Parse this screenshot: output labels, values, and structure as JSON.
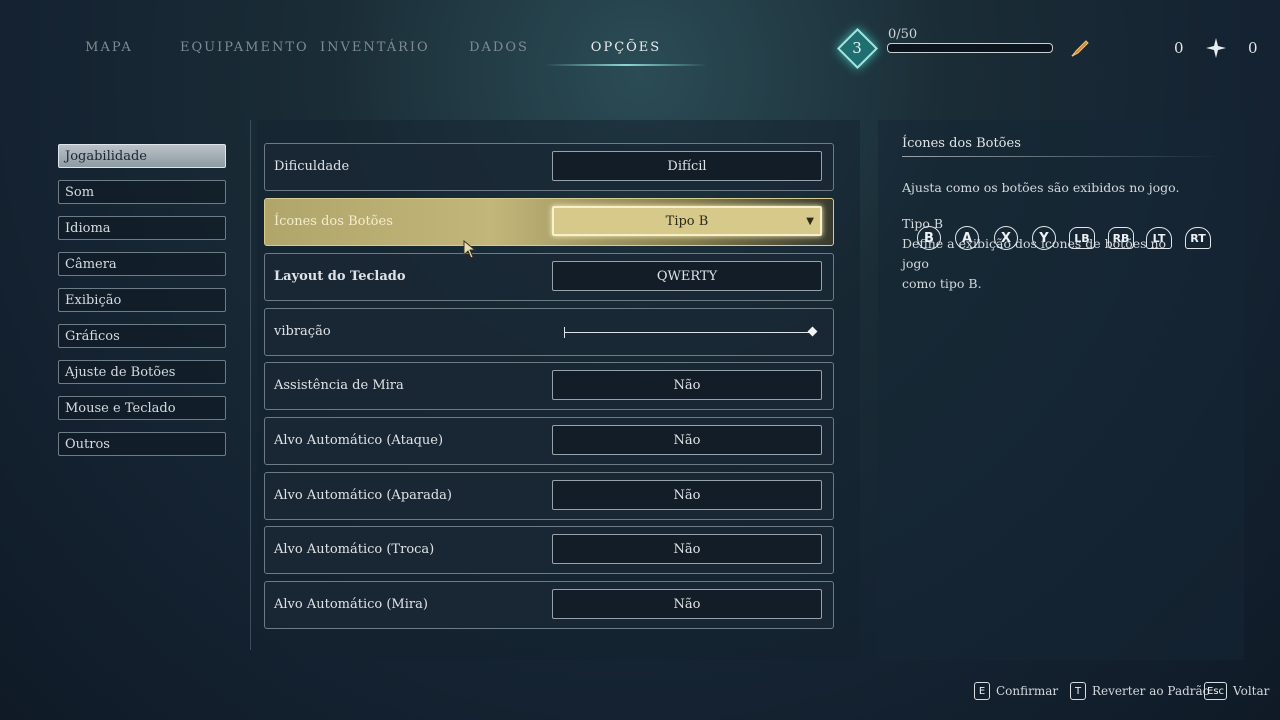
{
  "nav": {
    "tabs": [
      {
        "label": "MAPA"
      },
      {
        "label": "EQUIPAMENTO"
      },
      {
        "label": "INVENTÁRIO"
      },
      {
        "label": "DADOS"
      },
      {
        "label": "OPÇÕES"
      }
    ],
    "active_tab": "OPÇÕES"
  },
  "hud": {
    "level": "3",
    "xp_text": "0/50",
    "xp_progress": 0,
    "quill_count": "0",
    "star_count": "0"
  },
  "categories": [
    {
      "label": "Jogabilidade",
      "active": true
    },
    {
      "label": "Som"
    },
    {
      "label": "Idioma"
    },
    {
      "label": "Câmera"
    },
    {
      "label": "Exibição"
    },
    {
      "label": "Gráficos"
    },
    {
      "label": "Ajuste de Botões"
    },
    {
      "label": "Mouse e Teclado"
    },
    {
      "label": "Outros"
    }
  ],
  "settings": [
    {
      "label": "Dificuldade",
      "value": "Difícil"
    },
    {
      "label": "Ícones dos Botões",
      "value": "Tipo B",
      "active": true
    },
    {
      "label": "Layout do Teclado",
      "value": "QWERTY"
    },
    {
      "label": "vibração",
      "type": "slider",
      "level": 1.0
    },
    {
      "label": "Assistência de Mira",
      "value": "Não"
    },
    {
      "label": "Alvo Automático (Ataque)",
      "value": "Não"
    },
    {
      "label": "Alvo Automático (Aparada)",
      "value": "Não"
    },
    {
      "label": "Alvo Automático (Troca)",
      "value": "Não"
    },
    {
      "label": "Alvo Automático (Mira)",
      "value": "Não"
    }
  ],
  "info": {
    "title": "Ícones dos Botões",
    "description": "Ajusta como os botões são exibidos no jogo.",
    "option_name": "Tipo B",
    "option_desc_line1": "Define a exibição dos ícones de botões no jogo",
    "option_desc_line2": "como tipo B.",
    "button_icons": [
      "B",
      "A",
      "X",
      "Y",
      "LB",
      "RB",
      "LT",
      "RT"
    ]
  },
  "footer": {
    "confirm": {
      "key": "E",
      "label": "Confirmar"
    },
    "reset": {
      "key": "T",
      "label": "Reverter ao Padrão"
    },
    "back": {
      "key": "Esc",
      "label": "Voltar"
    }
  },
  "colors": {
    "accent": "#8ad7d2",
    "highlight": "#c2b67a"
  }
}
